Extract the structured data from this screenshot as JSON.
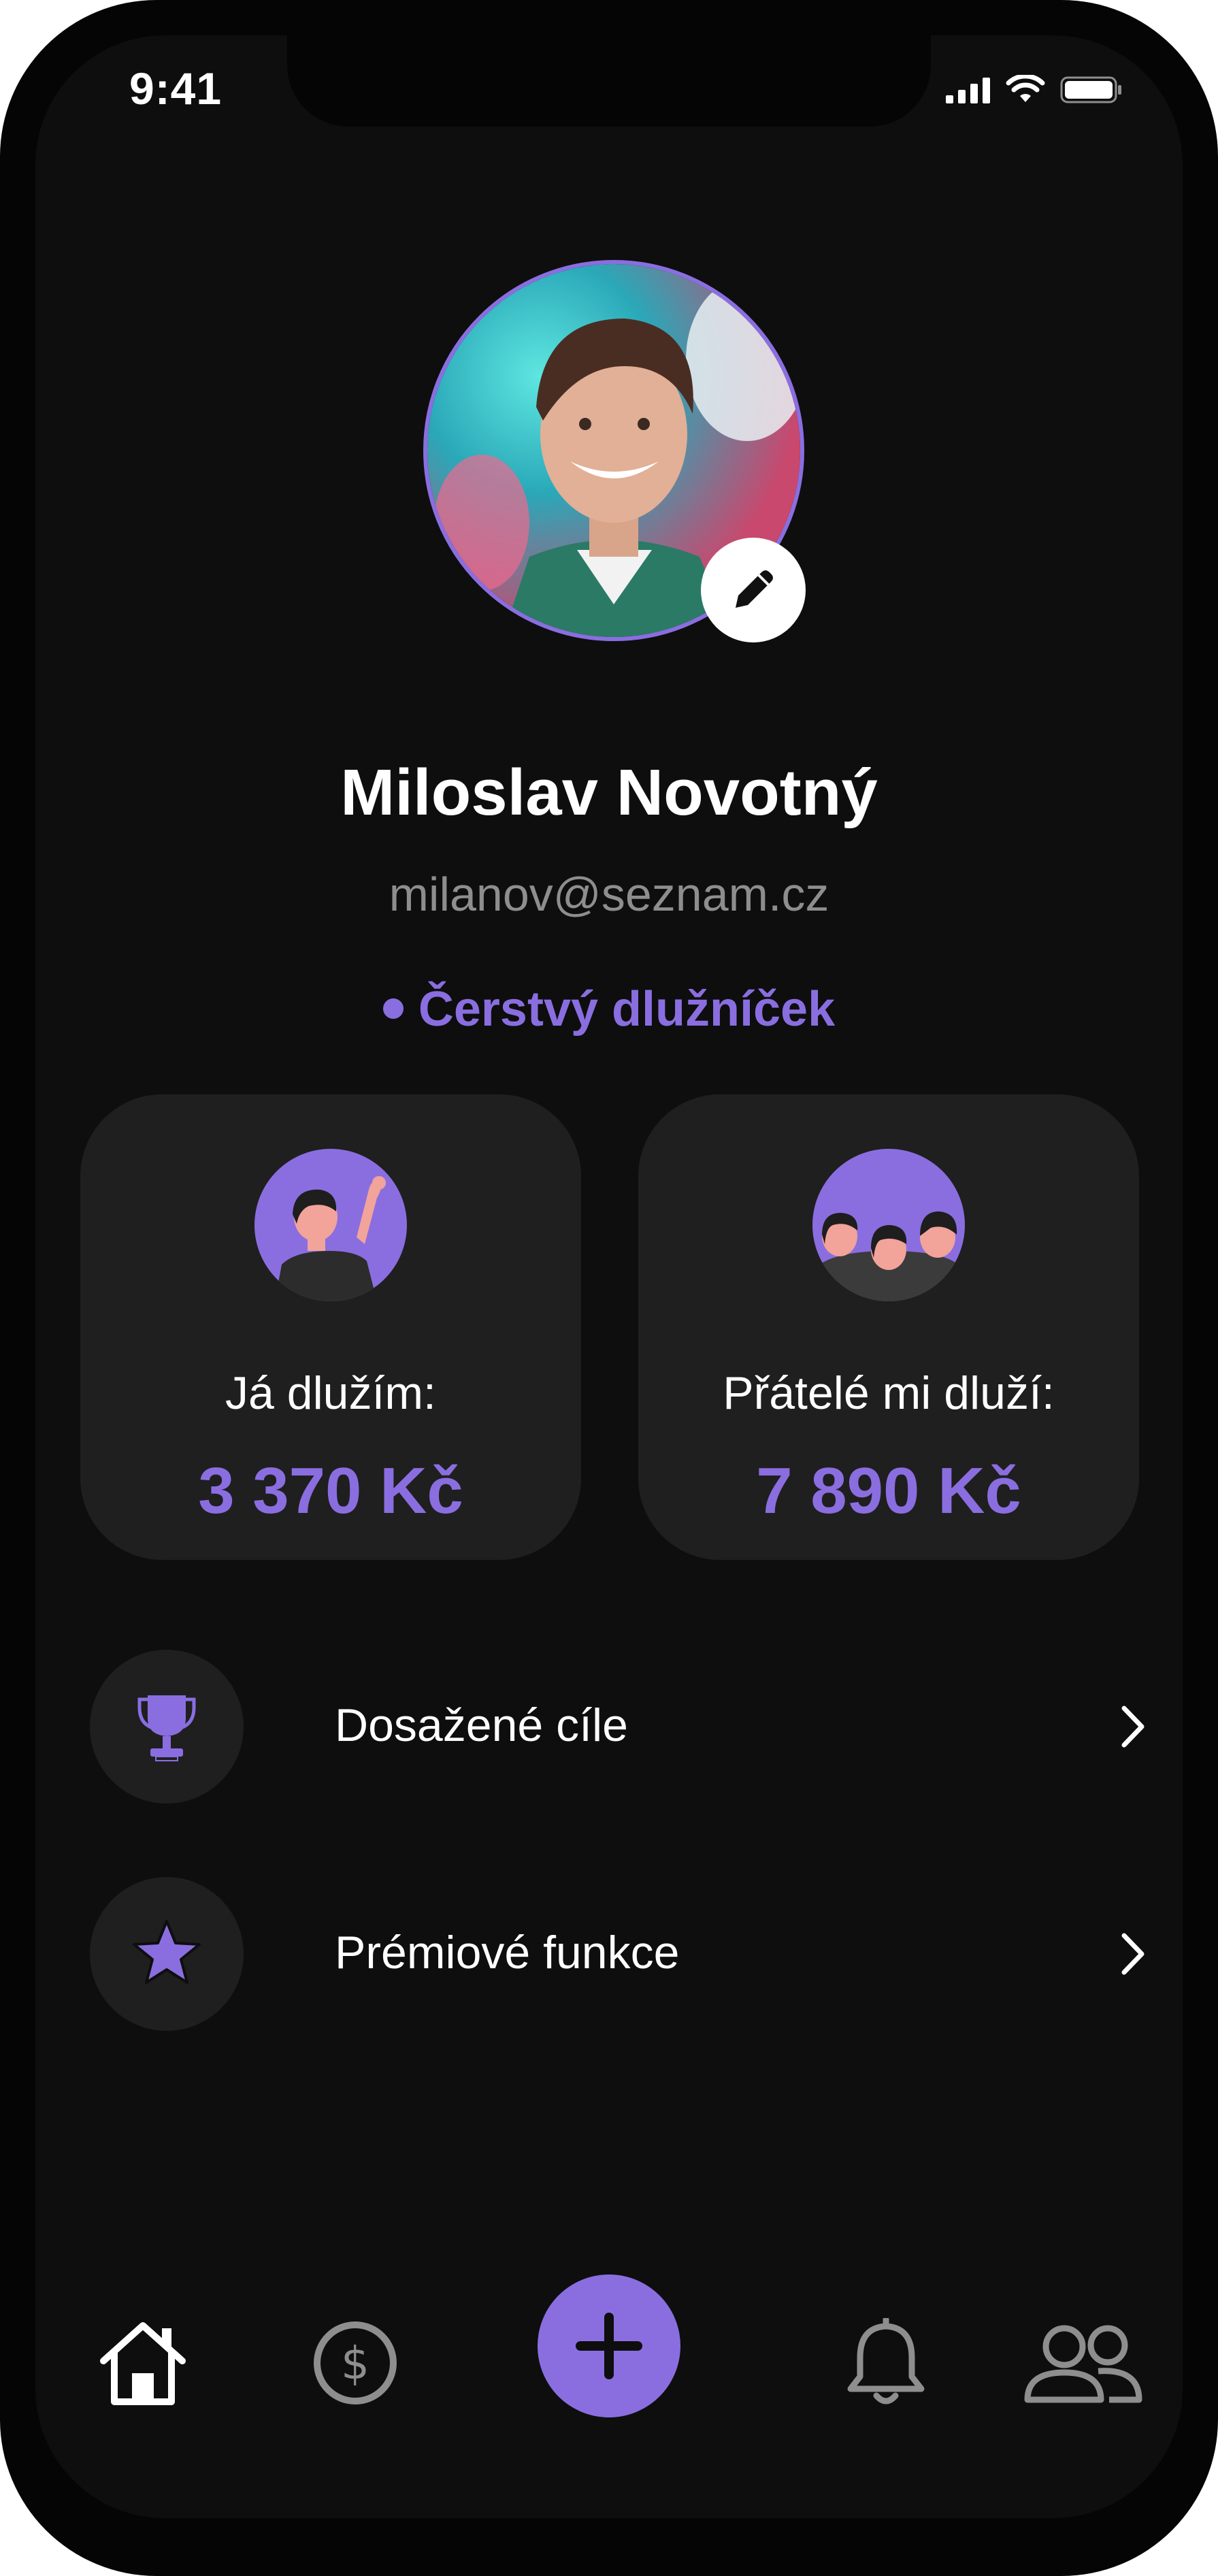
{
  "status_bar": {
    "time": "9:41"
  },
  "profile": {
    "name": "Miloslav Novotný",
    "email": "milanov@seznam.cz",
    "badge": "Čerstvý dlužníček"
  },
  "cards": [
    {
      "label": "Já dlužím:",
      "amount": "3 370 Kč"
    },
    {
      "label": "Přátelé mi dluží:",
      "amount": "7 890 Kč"
    }
  ],
  "menu": [
    {
      "label": "Dosažené cíle",
      "icon": "trophy-icon"
    },
    {
      "label": "Prémiové funkce",
      "icon": "star-icon"
    }
  ],
  "bottom_nav": [
    "home-icon",
    "dollar-icon",
    "plus-icon",
    "bell-icon",
    "friends-icon"
  ],
  "colors": {
    "accent": "#8a6ee0",
    "background": "#0e0e0e",
    "card": "#1f1f1f",
    "muted": "#8e8e8e"
  }
}
